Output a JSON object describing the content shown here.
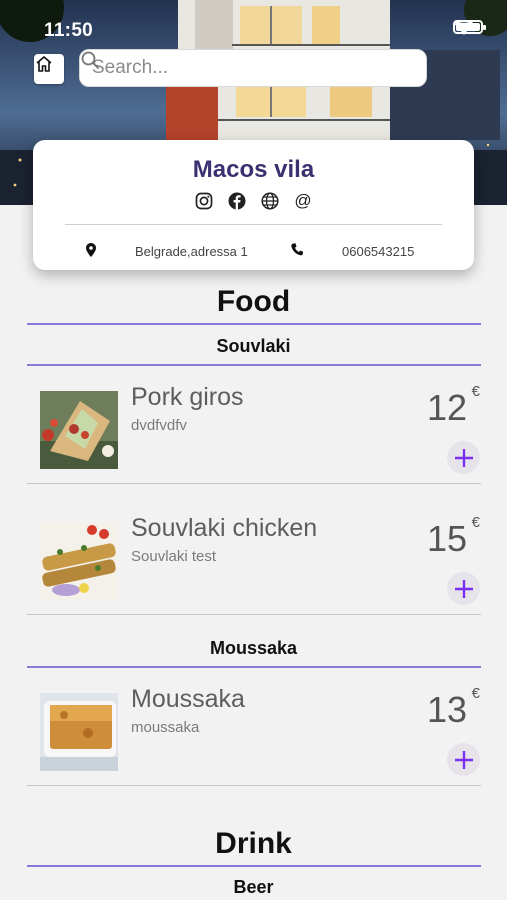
{
  "status_bar": {
    "time": "11:50"
  },
  "search": {
    "placeholder": "Search..."
  },
  "restaurant": {
    "name": "Macos vila",
    "address": "Belgrade,adressa 1",
    "phone": "0606543215",
    "social_icons": [
      "instagram-icon",
      "facebook-icon",
      "globe-icon",
      "email-icon"
    ],
    "email_glyph": "@"
  },
  "colors": {
    "accent": "#8a78d8",
    "brand": "#3b3070",
    "plus": "#7b2ff0"
  },
  "menu": {
    "sections": [
      {
        "title": "Food",
        "categories": [
          {
            "title": "Souvlaki",
            "items": [
              {
                "name": "Pork giros",
                "description": "dvdfvdfv",
                "price": "12",
                "currency": "€"
              },
              {
                "name": "Souvlaki chicken",
                "description": "Souvlaki test",
                "price": "15",
                "currency": "€"
              }
            ]
          },
          {
            "title": "Moussaka",
            "items": [
              {
                "name": "Moussaka",
                "description": "moussaka",
                "price": "13",
                "currency": "€"
              }
            ]
          }
        ]
      },
      {
        "title": "Drink",
        "categories": [
          {
            "title": "Beer",
            "items": []
          }
        ]
      }
    ]
  }
}
